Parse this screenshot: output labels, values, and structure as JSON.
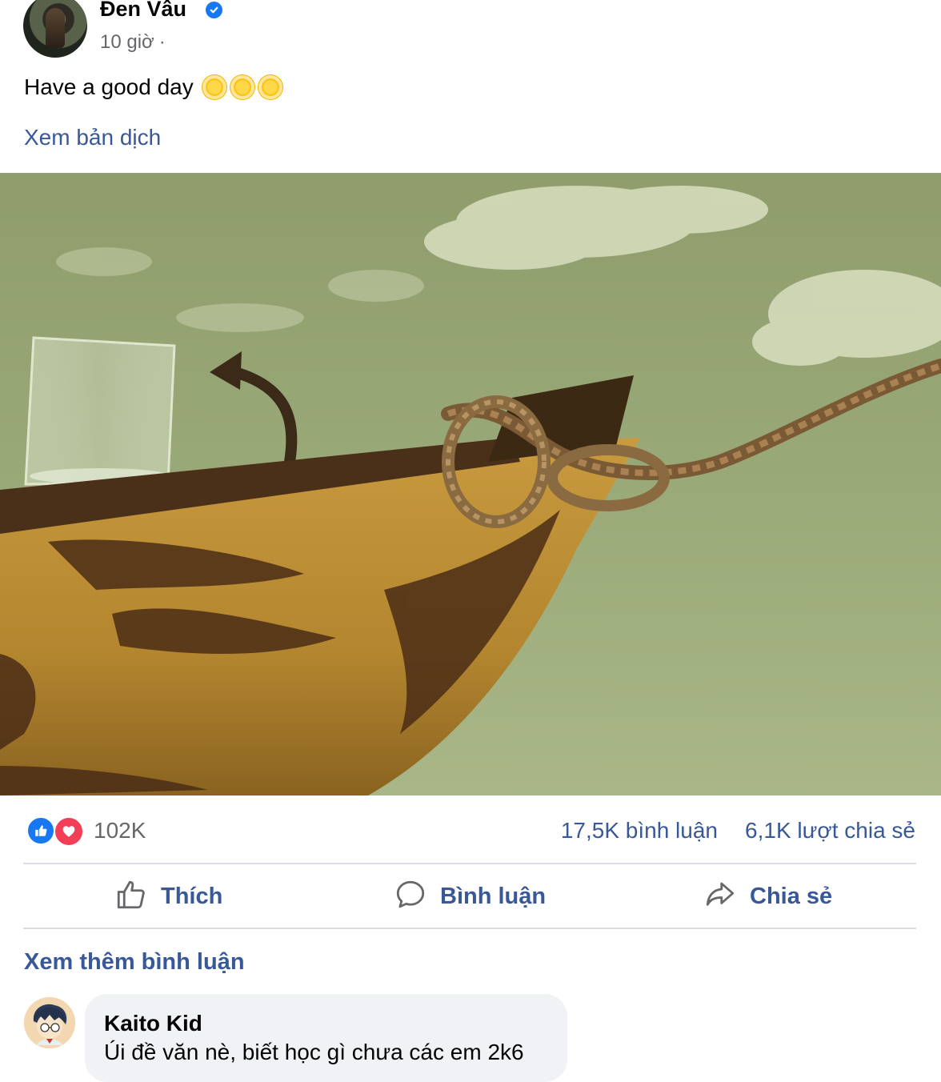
{
  "post": {
    "author": "Đen Vâu",
    "time": "10 giờ",
    "time_separator": "·",
    "text": "Have a good day",
    "translate_link": "Xem bản dịch",
    "icons": [
      "verified-badge-icon",
      "sun-emoji-icon",
      "sun-emoji-icon",
      "sun-emoji-icon"
    ]
  },
  "stats": {
    "reactions": "102K",
    "reaction_icons": [
      "like-reaction-icon",
      "love-reaction-icon"
    ],
    "comments": "17,5K bình luận",
    "shares": "6,1K lượt chia sẻ"
  },
  "actions": {
    "like": "Thích",
    "comment": "Bình luận",
    "share": "Chia sẻ"
  },
  "comments_section": {
    "more_comments": "Xem thêm bình luận",
    "items": [
      {
        "author": "Kaito Kid",
        "text": "Úi đề văn nè, biết học gì chưa các em 2k6"
      }
    ]
  },
  "colors": {
    "link": "#385898",
    "secondary_text": "#65676b",
    "like_blue": "#1877f2",
    "love_red": "#f33e58",
    "bubble_bg": "#f0f2f5",
    "divider": "#dadde1"
  }
}
